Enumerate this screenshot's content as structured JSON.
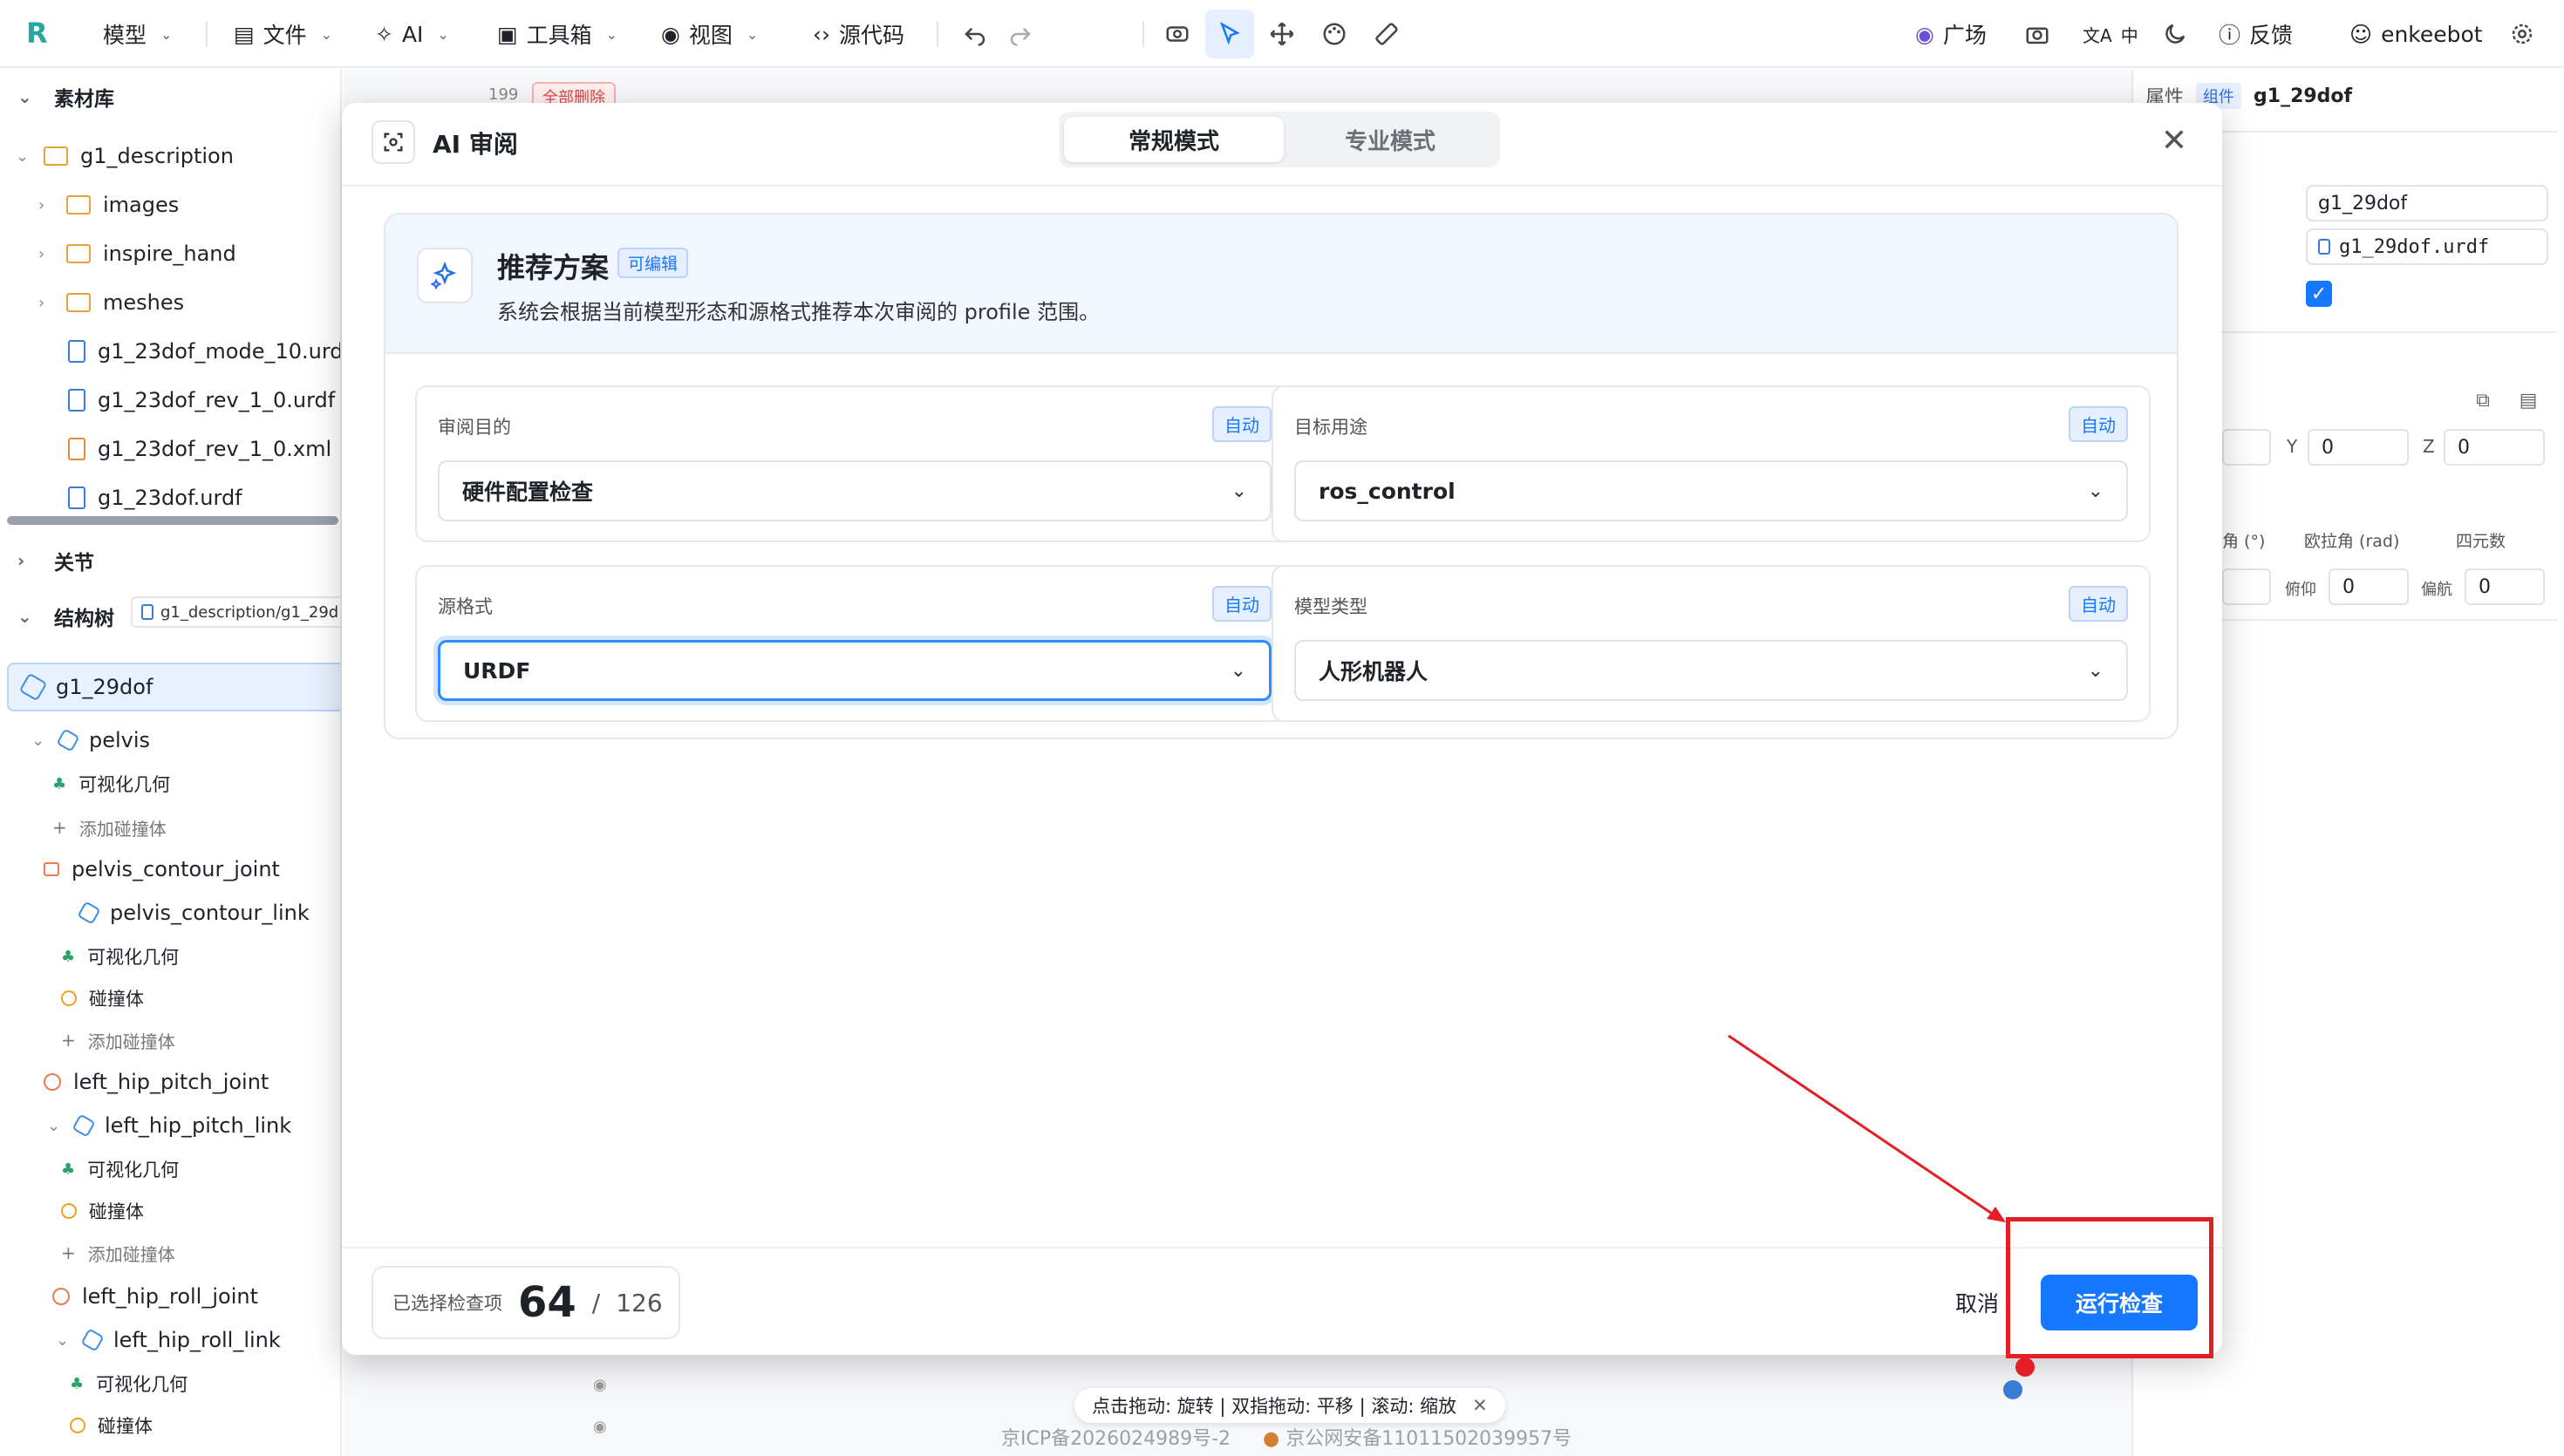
{
  "toolbar": {
    "model": "模型",
    "file": "文件",
    "ai": "AI",
    "toolbox": "工具箱",
    "view": "视图",
    "source": "源代码",
    "plaza": "广场",
    "lang": "中",
    "feedback": "反馈",
    "user": "enkeebot"
  },
  "sidebar": {
    "assets_title": "素材库",
    "asset_count": "199",
    "delete_all": "全部删除",
    "files": {
      "root": "g1_description",
      "images": "images",
      "inspire_hand": "inspire_hand",
      "meshes": "meshes",
      "f1": "g1_23dof_mode_10.urdf",
      "f2": "g1_23dof_rev_1_0.urdf",
      "f3": "g1_23dof_rev_1_0.xml",
      "f4": "g1_23dof.urdf"
    },
    "joints_title": "关节",
    "tree_title": "结构树",
    "tree_path": "g1_description/g1_29d",
    "tree": {
      "root": "g1_29dof",
      "pelvis": "pelvis",
      "vis1": "可视化几何",
      "addcol1": "添加碰撞体",
      "pcj": "pelvis_contour_joint",
      "pcl": "pelvis_contour_link",
      "vis2": "可视化几何",
      "col2": "碰撞体",
      "addcol2": "添加碰撞体",
      "lhpj": "left_hip_pitch_joint",
      "lhpl": "left_hip_pitch_link",
      "vis3": "可视化几何",
      "col3": "碰撞体",
      "addcol3": "添加碰撞体",
      "lhrj": "left_hip_roll_joint",
      "lhrl": "left_hip_roll_link",
      "vis4": "可视化几何",
      "col4": "碰撞体"
    }
  },
  "right_panel": {
    "tab_props": "属性",
    "tag": "组件",
    "name": "g1_29dof",
    "name_input": "g1_29dof",
    "file_input": "g1_29dof.urdf",
    "y_label": "Y",
    "y_val": "0",
    "z_label": "Z",
    "z_val": "0",
    "deg_label": "角 (°)",
    "euler_label": "欧拉角 (rad)",
    "quat_label": "四元数",
    "pitch_label": "俯仰",
    "pitch_val": "0",
    "yaw_label": "偏航",
    "yaw_val": "0"
  },
  "modal": {
    "title": "AI 审阅",
    "tab_normal": "常规模式",
    "tab_pro": "专业模式",
    "plan_title": "推荐方案",
    "editable": "可编辑",
    "plan_desc": "系统会根据当前模型形态和源格式推荐本次审阅的 profile 范围。",
    "fields": {
      "purpose_label": "审阅目的",
      "purpose_value": "硬件配置检查",
      "target_label": "目标用途",
      "target_value": "ros_control",
      "format_label": "源格式",
      "format_value": "URDF",
      "type_label": "模型类型",
      "type_value": "人形机器人",
      "auto": "自动"
    },
    "selected_label": "已选择检查项",
    "selected_count": "64",
    "total_sep": "/",
    "total_count": "126",
    "cancel": "取消",
    "run": "运行检查"
  },
  "canvas": {
    "hint": "点击拖动: 旋转 | 双指拖动: 平移 | 滚动: 缩放",
    "icp": "京ICP备2026024989号-2",
    "police": "京公网安备11011502039957号"
  },
  "colors": {
    "primary": "#1677ff",
    "annotation": "#e31e24"
  }
}
